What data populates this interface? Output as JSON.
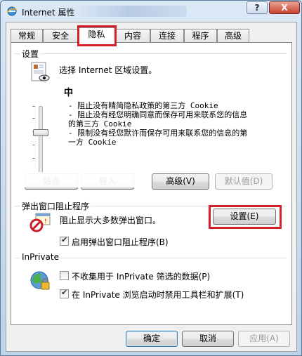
{
  "window": {
    "title": "Internet 属性",
    "help_label": "?",
    "close_label": "X"
  },
  "tabs": [
    {
      "label": "常规"
    },
    {
      "label": "安全"
    },
    {
      "label": "隐私",
      "active": true
    },
    {
      "label": "内容"
    },
    {
      "label": "连接"
    },
    {
      "label": "程序"
    },
    {
      "label": "高级"
    }
  ],
  "privacy": {
    "group_title": "设置",
    "instruction": "选择 Internet 区域设置。",
    "level": "中",
    "bullets": [
      "- 阻止没有精简隐私政策的第三方 Cookie",
      "- 阻止没有经您明确同意而保存可用来联系您的信息",
      "的第三方 Cookie",
      "- 限制没有经您默许而保存可用来联系您的信息的第",
      "一方 Cookie"
    ],
    "buttons": {
      "sites": "站点",
      "import": "导入",
      "advanced": "高级(V)",
      "default": "默认值(D)"
    }
  },
  "popup": {
    "group_title": "弹出窗口阻止程序",
    "description": "阻止显示大多数弹出窗口。",
    "settings_button": "设置(E)",
    "enable_label": "启用弹出窗口阻止程序(B)",
    "enable_checked": true
  },
  "inprivate": {
    "group_title": "InPrivate",
    "no_collect_label": "不收集用于 InPrivate 筛选的数据(P)",
    "no_collect_checked": false,
    "disable_toolbars_label": "在 InPrivate 浏览启动时禁用工具栏和扩展(T)",
    "disable_toolbars_checked": true
  },
  "footer": {
    "ok": "确定",
    "cancel": "取消",
    "apply": "应用(A)"
  },
  "colors": {
    "highlight": "#d4202a",
    "title_gradient_top": "#dbe8f6",
    "close_button": "#c7422e"
  }
}
